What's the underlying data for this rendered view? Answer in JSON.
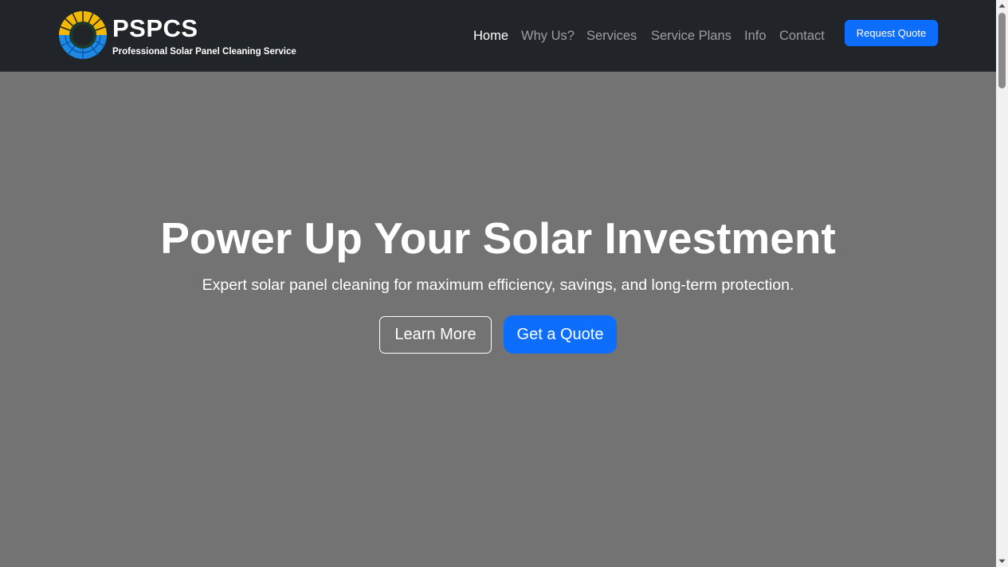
{
  "brand": {
    "name": "PSPCS",
    "tagline": "Professional Solar Panel Cleaning Service",
    "logo_colors": {
      "sun": "#f5b800",
      "panel": "#1e88e5",
      "ring": "#1b5e20"
    }
  },
  "nav": {
    "links": [
      {
        "label": "Home",
        "active": true
      },
      {
        "label": "Why Us?"
      },
      {
        "label": "Services"
      },
      {
        "label": "Service Plans"
      },
      {
        "label": "Info"
      },
      {
        "label": "Contact"
      }
    ],
    "cta_label": "Request Quote"
  },
  "hero": {
    "title": "Power Up Your Solar Investment",
    "subtitle": "Expert solar panel cleaning for maximum efficiency, savings, and long-term protection.",
    "secondary_button": "Learn More",
    "primary_button": "Get a Quote"
  },
  "colors": {
    "navbar_bg": "#212529",
    "hero_bg": "#737373",
    "accent": "#0d6efd"
  }
}
